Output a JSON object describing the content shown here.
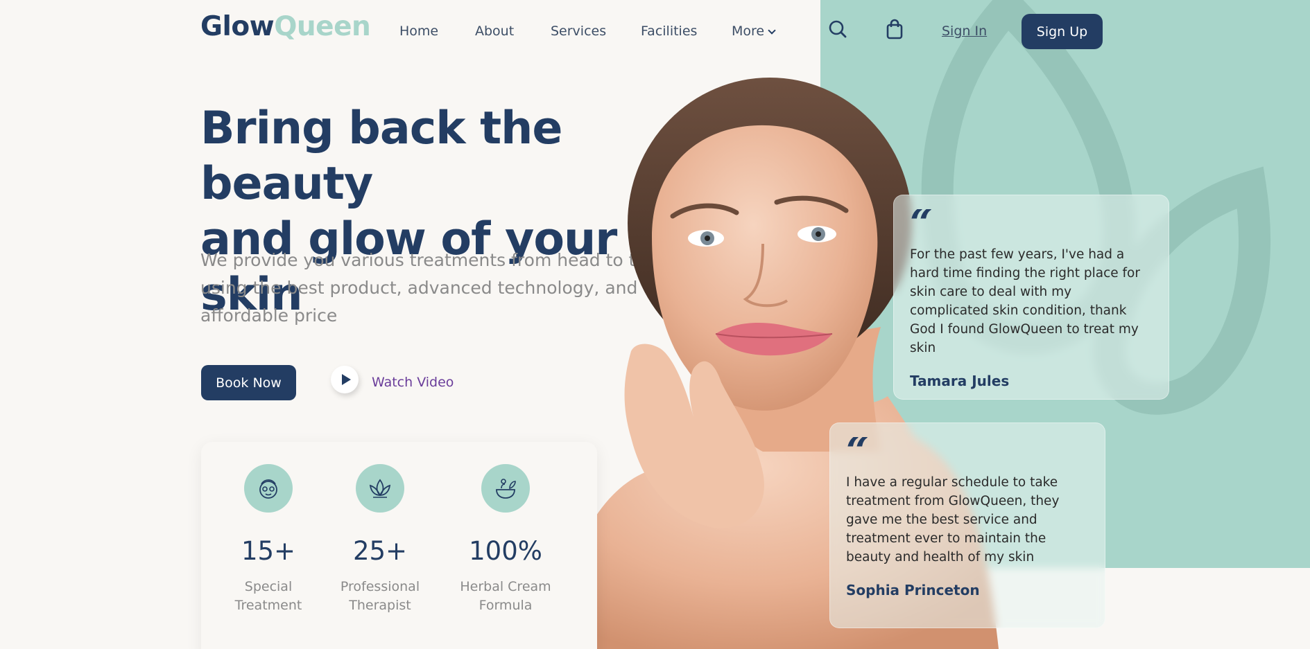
{
  "header": {
    "logo_part1": "Glow",
    "logo_part2": "Queen",
    "nav": [
      "Home",
      "About",
      "Services",
      "Facilities",
      "More"
    ],
    "sign_in": "Sign In",
    "sign_up": "Sign Up"
  },
  "hero": {
    "headline_line1": "Bring back the beauty",
    "headline_line2": "and glow of your skin",
    "subtext": "We provide you various treatments from head to toe using the best product, advanced technology, and affordable price",
    "book_button": "Book Now",
    "watch_video": "Watch Video"
  },
  "stats": [
    {
      "value": "15+",
      "label_line1": "Special",
      "label_line2": "Treatment",
      "icon": "face-mask-icon"
    },
    {
      "value": "25+",
      "label_line1": "Professional",
      "label_line2": "Therapist",
      "icon": "lotus-icon"
    },
    {
      "value": "100%",
      "label_line1": "Herbal Cream",
      "label_line2": "Formula",
      "icon": "herbal-bowl-icon"
    }
  ],
  "testimonials": [
    {
      "quote": "For the past few years, I've had a hard time finding the right place for skin care to deal with my complicated skin condition, thank God I found GlowQueen to treat my skin",
      "name": "Tamara Jules"
    },
    {
      "quote": "I have a regular schedule to take treatment from GlowQueen, they gave me the best service and treatment ever to maintain the beauty and health of my skin",
      "name": "Sophia Princeton"
    }
  ],
  "colors": {
    "navy": "#233d63",
    "mint": "#a8d5ca",
    "cream": "#f9f7f4",
    "link_purple": "#6a3d9a"
  }
}
